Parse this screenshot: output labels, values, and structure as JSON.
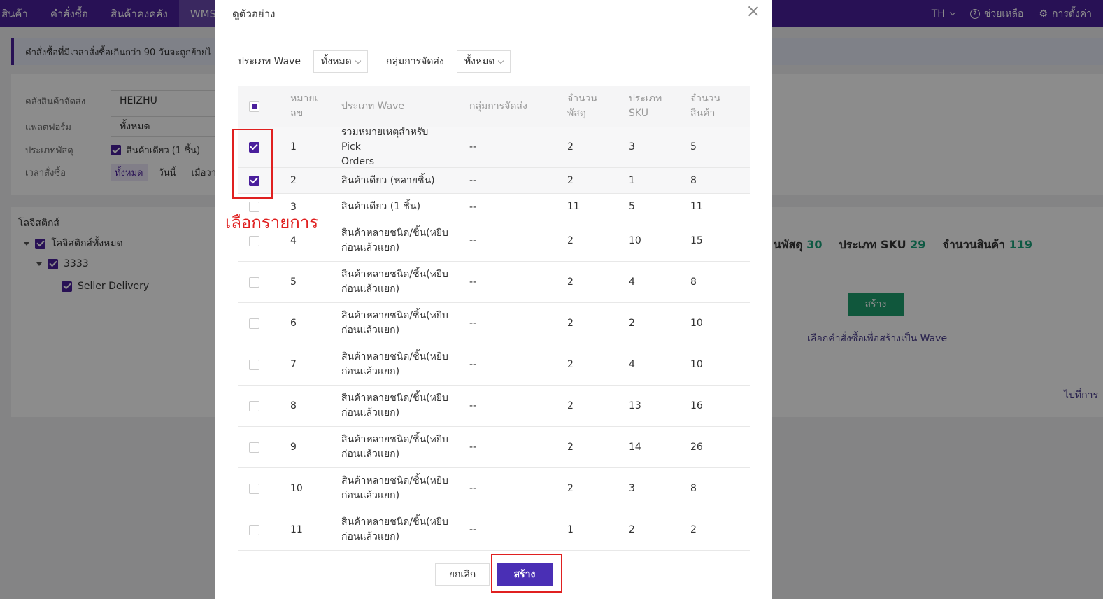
{
  "nav": {
    "items": [
      "สินค้า",
      "คำสั่งซื้อ",
      "สินค้าคงคลัง",
      "WMS"
    ],
    "lang": "TH",
    "help": "ช่วยเหลือ",
    "settings": "การตั้งค่า"
  },
  "notice": "คำสั่งซื้อที่มีเวลาสั่งซื้อเกินกว่า 90 วันจะถูกย้ายไ",
  "filters": {
    "warehouse_label": "คลังสินค้าจัดส่ง",
    "warehouse_value": "HEIZHU",
    "platform_label": "แพลตฟอร์ม",
    "platform_value": "ทั้งหมด",
    "parcel_type_label": "ประเภทพัสดุ",
    "parcel_type_value": "สินค้าเดียว (1 ชิ้น)",
    "order_time_label": "เวลาสั่งซื้อ",
    "order_time_options": [
      "ทั้งหมด",
      "วันนี้",
      "เมื่อวา"
    ]
  },
  "logistics": {
    "title": "โลจิสติกส์",
    "all": "โลจิสติกส์ทั้งหมด",
    "group": "3333",
    "item": "Seller Delivery"
  },
  "stats": {
    "parcel_label": "นพัสดุ",
    "parcel_value": "30",
    "sku_label": "ประเภท SKU",
    "sku_value": "29",
    "qty_label": "จำนวนสินค้า",
    "qty_value": "119"
  },
  "background_create": "สร้าง",
  "background_hint": "เลือกคำสั่งซื้อเพื่อสร้างเป็น Wave",
  "background_goto": "ไปที่การ",
  "modal": {
    "title": "ดูตัวอย่าง",
    "wave_type_label": "ประเภท Wave",
    "wave_type_value": "ทั้งหมด",
    "shipping_group_label": "กลุ่มการจัดส่ง",
    "shipping_group_value": "ทั้งหมด",
    "columns": {
      "no_1": "หมายเ",
      "no_2": "ลข",
      "type": "ประเภท Wave",
      "group": "กลุ่มการจัดส่ง",
      "parcels_1": "จำนวน",
      "parcels_2": "พัสดุ",
      "sku_1": "ประเภท",
      "sku_2": "SKU",
      "qty_1": "จำนวน",
      "qty_2": "สินค้า"
    },
    "rows": [
      {
        "no": "1",
        "type1": "รวมหมายเหตุสำหรับ Pick",
        "type2": "Orders",
        "group": "--",
        "parcels": "2",
        "sku": "3",
        "qty": "5",
        "checked": true
      },
      {
        "no": "2",
        "type1": "สินค้าเดียว (หลายชิ้น)",
        "type2": "",
        "group": "--",
        "parcels": "2",
        "sku": "1",
        "qty": "8",
        "checked": true
      },
      {
        "no": "3",
        "type1": "สินค้าเดียว (1 ชิ้น)",
        "type2": "",
        "group": "--",
        "parcels": "11",
        "sku": "5",
        "qty": "11",
        "checked": false
      },
      {
        "no": "4",
        "type1": "สินค้าหลายชนิด/ชิ้น(หยิบ",
        "type2": "ก่อนแล้วแยก)",
        "group": "--",
        "parcels": "2",
        "sku": "10",
        "qty": "15",
        "checked": false
      },
      {
        "no": "5",
        "type1": "สินค้าหลายชนิด/ชิ้น(หยิบ",
        "type2": "ก่อนแล้วแยก)",
        "group": "--",
        "parcels": "2",
        "sku": "4",
        "qty": "8",
        "checked": false
      },
      {
        "no": "6",
        "type1": "สินค้าหลายชนิด/ชิ้น(หยิบ",
        "type2": "ก่อนแล้วแยก)",
        "group": "--",
        "parcels": "2",
        "sku": "2",
        "qty": "10",
        "checked": false
      },
      {
        "no": "7",
        "type1": "สินค้าหลายชนิด/ชิ้น(หยิบ",
        "type2": "ก่อนแล้วแยก)",
        "group": "--",
        "parcels": "2",
        "sku": "4",
        "qty": "10",
        "checked": false
      },
      {
        "no": "8",
        "type1": "สินค้าหลายชนิด/ชิ้น(หยิบ",
        "type2": "ก่อนแล้วแยก)",
        "group": "--",
        "parcels": "2",
        "sku": "13",
        "qty": "16",
        "checked": false
      },
      {
        "no": "9",
        "type1": "สินค้าหลายชนิด/ชิ้น(หยิบ",
        "type2": "ก่อนแล้วแยก)",
        "group": "--",
        "parcels": "2",
        "sku": "14",
        "qty": "26",
        "checked": false
      },
      {
        "no": "10",
        "type1": "สินค้าหลายชนิด/ชิ้น(หยิบ",
        "type2": "ก่อนแล้วแยก)",
        "group": "--",
        "parcels": "2",
        "sku": "3",
        "qty": "8",
        "checked": false
      },
      {
        "no": "11",
        "type1": "สินค้าหลายชนิด/ชิ้น(หยิบ",
        "type2": "ก่อนแล้วแยก)",
        "group": "--",
        "parcels": "1",
        "sku": "2",
        "qty": "2",
        "checked": false
      }
    ],
    "cancel": "ยกเลิก",
    "create": "สร้าง"
  },
  "annotation": "เลือกรายการ",
  "colors": {
    "brand": "#4a1f9c",
    "accent_green": "#1e9e6e",
    "annotation_red": "#e02020"
  }
}
